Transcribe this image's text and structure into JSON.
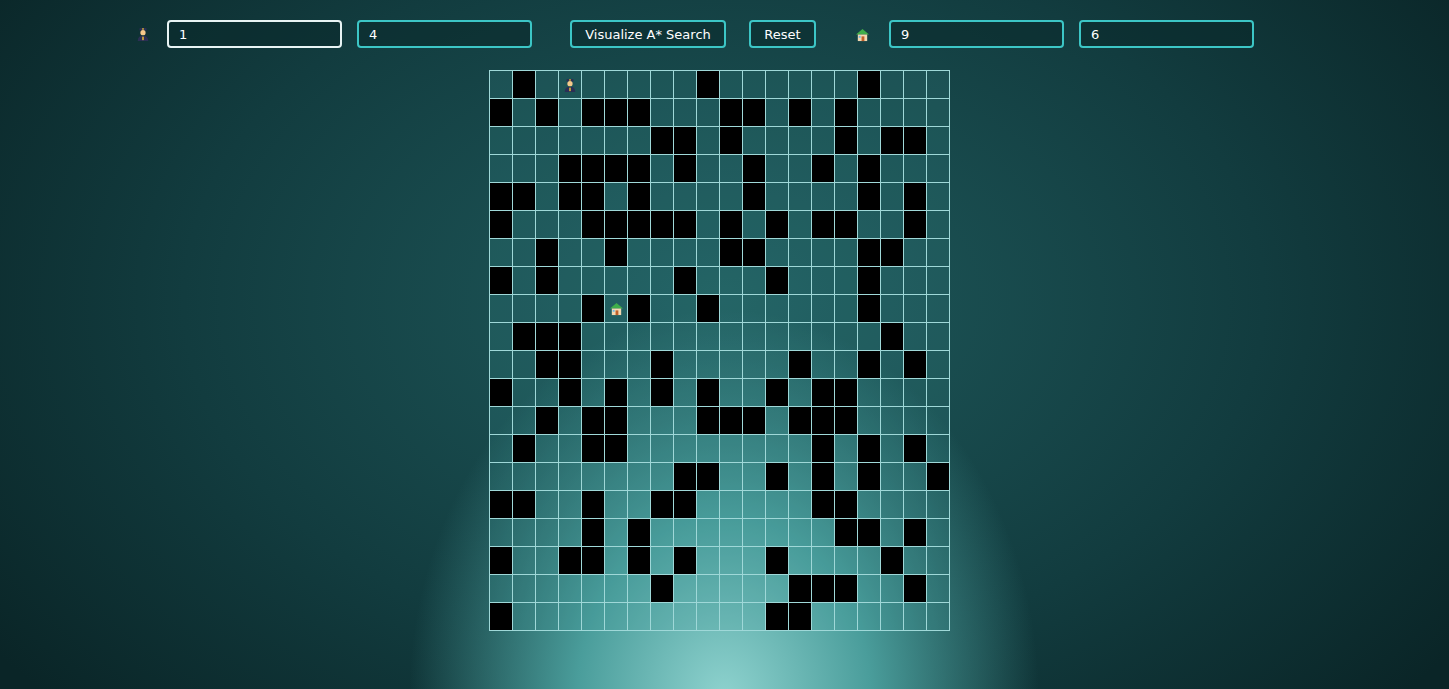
{
  "toolbar": {
    "start_fields": [
      {
        "value": "1",
        "focused": true
      },
      {
        "value": "4",
        "focused": false
      }
    ],
    "visualize_button": "Visualize A* Search",
    "reset_button": "Reset",
    "end_fields": [
      {
        "value": "9",
        "focused": false
      },
      {
        "value": "6",
        "focused": false
      }
    ]
  },
  "grid": {
    "legend": "0 empty, 1 wall, 2 start, 3 end",
    "rows": [
      [
        0,
        1,
        0,
        2,
        0,
        0,
        0,
        0,
        0,
        1,
        0,
        0,
        0,
        0,
        0,
        0,
        1,
        0,
        0,
        0
      ],
      [
        1,
        0,
        1,
        0,
        1,
        1,
        1,
        0,
        0,
        0,
        1,
        1,
        0,
        1,
        0,
        1,
        0,
        0,
        0,
        0
      ],
      [
        0,
        0,
        0,
        0,
        0,
        0,
        0,
        1,
        1,
        0,
        1,
        0,
        0,
        0,
        0,
        1,
        0,
        1,
        1,
        0
      ],
      [
        0,
        0,
        0,
        1,
        1,
        1,
        1,
        0,
        1,
        0,
        0,
        1,
        0,
        0,
        1,
        0,
        1,
        0,
        0,
        0
      ],
      [
        1,
        1,
        0,
        1,
        1,
        0,
        1,
        0,
        0,
        0,
        0,
        1,
        0,
        0,
        0,
        0,
        1,
        0,
        1,
        0
      ],
      [
        1,
        0,
        0,
        0,
        1,
        1,
        1,
        1,
        1,
        0,
        1,
        0,
        1,
        0,
        1,
        1,
        0,
        0,
        1,
        0
      ],
      [
        0,
        0,
        1,
        0,
        0,
        1,
        0,
        0,
        0,
        0,
        1,
        1,
        0,
        0,
        0,
        0,
        1,
        1,
        0,
        0
      ],
      [
        1,
        0,
        1,
        0,
        0,
        0,
        0,
        0,
        1,
        0,
        0,
        0,
        1,
        0,
        0,
        0,
        1,
        0,
        0,
        0
      ],
      [
        0,
        0,
        0,
        0,
        1,
        3,
        1,
        0,
        0,
        1,
        0,
        0,
        0,
        0,
        0,
        0,
        1,
        0,
        0,
        0
      ],
      [
        0,
        1,
        1,
        1,
        0,
        0,
        0,
        0,
        0,
        0,
        0,
        0,
        0,
        0,
        0,
        0,
        0,
        1,
        0,
        0
      ],
      [
        0,
        0,
        1,
        1,
        0,
        0,
        0,
        1,
        0,
        0,
        0,
        0,
        0,
        1,
        0,
        0,
        1,
        0,
        1,
        0
      ],
      [
        1,
        0,
        0,
        1,
        0,
        1,
        0,
        1,
        0,
        1,
        0,
        0,
        1,
        0,
        1,
        1,
        0,
        0,
        0,
        0
      ],
      [
        0,
        0,
        1,
        0,
        1,
        1,
        0,
        0,
        0,
        1,
        1,
        1,
        0,
        1,
        1,
        1,
        0,
        0,
        0,
        0
      ],
      [
        0,
        1,
        0,
        0,
        1,
        1,
        0,
        0,
        0,
        0,
        0,
        0,
        0,
        0,
        1,
        0,
        1,
        0,
        1,
        0
      ],
      [
        0,
        0,
        0,
        0,
        0,
        0,
        0,
        0,
        1,
        1,
        0,
        0,
        1,
        0,
        1,
        0,
        1,
        0,
        0,
        1
      ],
      [
        1,
        1,
        0,
        0,
        1,
        0,
        0,
        1,
        1,
        0,
        0,
        0,
        0,
        0,
        1,
        1,
        0,
        0,
        0,
        0
      ],
      [
        0,
        0,
        0,
        0,
        1,
        0,
        1,
        0,
        0,
        0,
        0,
        0,
        0,
        0,
        0,
        1,
        1,
        0,
        1,
        0
      ],
      [
        1,
        0,
        0,
        1,
        1,
        0,
        1,
        0,
        1,
        0,
        0,
        0,
        1,
        0,
        0,
        0,
        0,
        1,
        0,
        0
      ],
      [
        0,
        0,
        0,
        0,
        0,
        0,
        0,
        1,
        0,
        0,
        0,
        0,
        0,
        1,
        1,
        1,
        0,
        0,
        1,
        0
      ],
      [
        1,
        0,
        0,
        0,
        0,
        0,
        0,
        0,
        0,
        0,
        0,
        0,
        1,
        1,
        0,
        0,
        0,
        0,
        0,
        0
      ]
    ]
  }
}
